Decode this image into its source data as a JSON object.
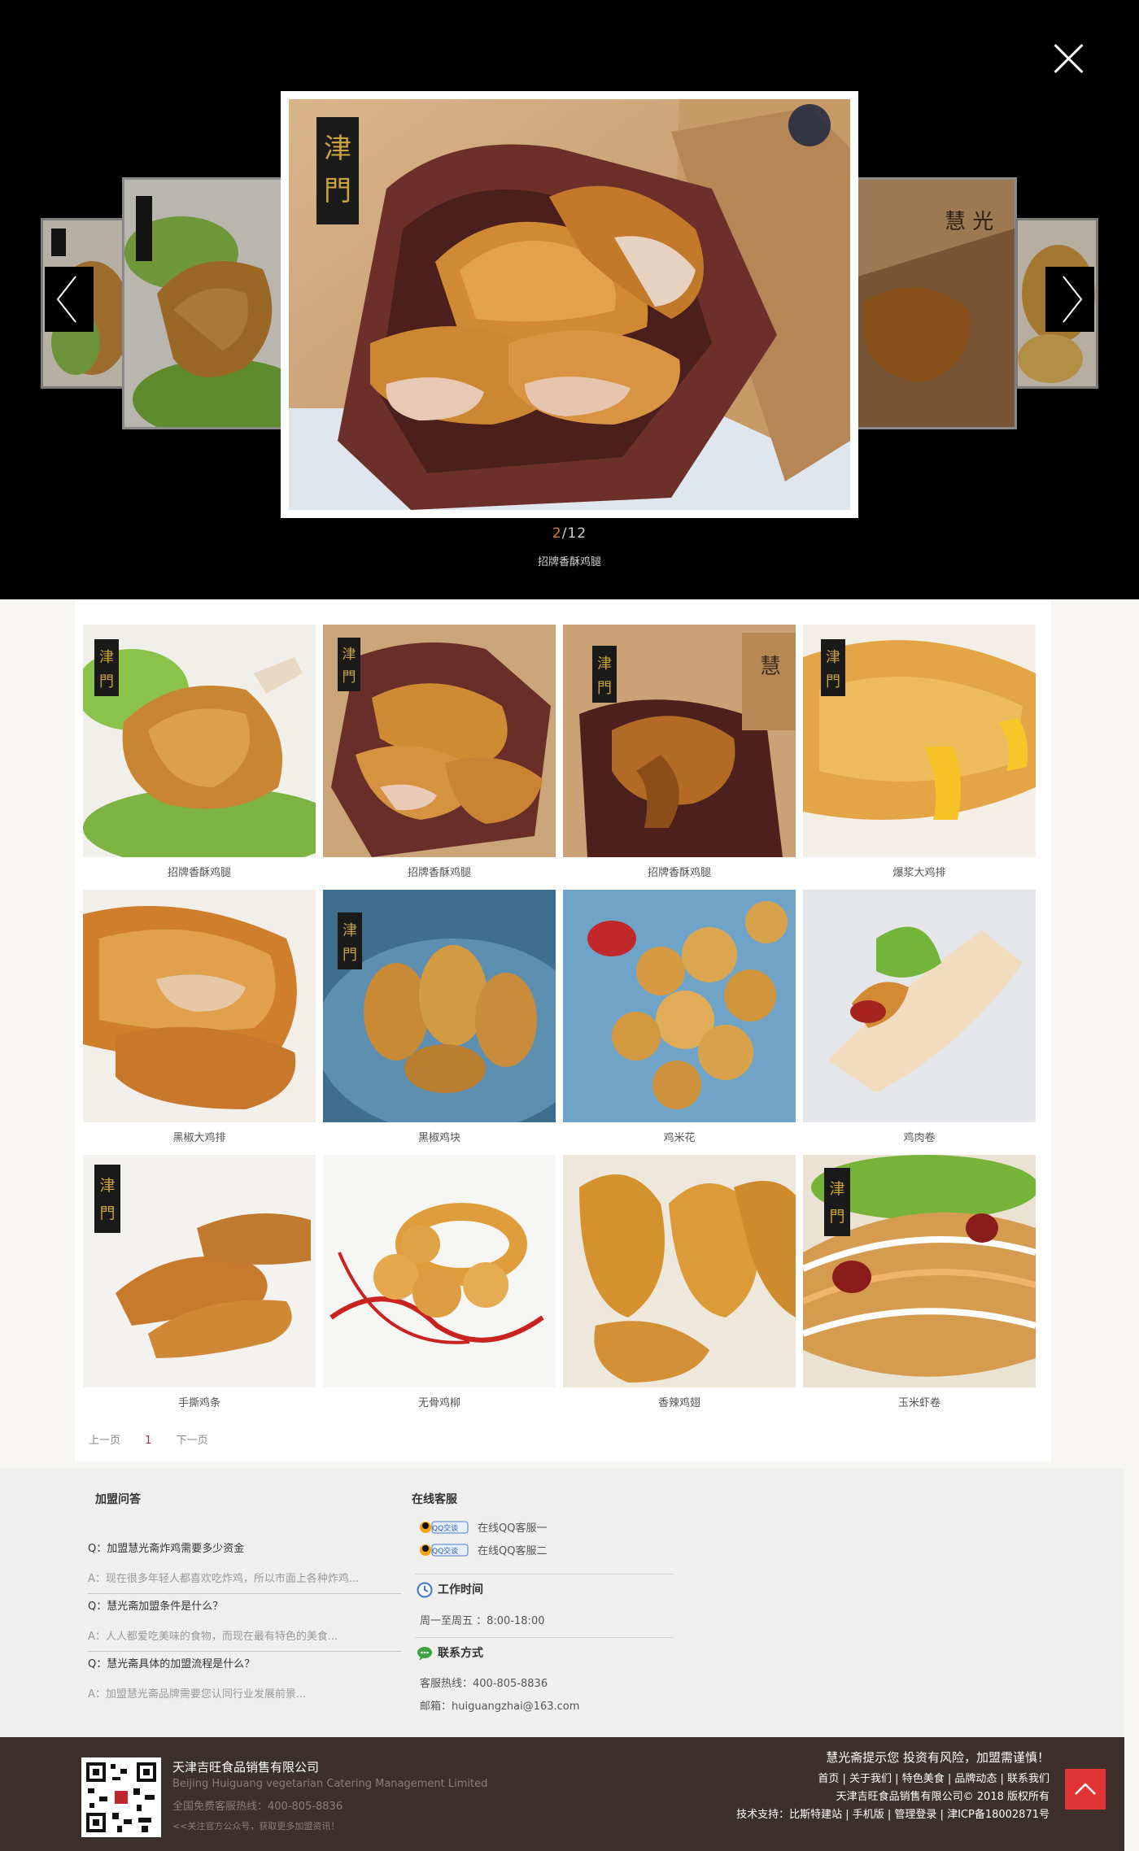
{
  "lightbox": {
    "current": "2",
    "separator": "/",
    "total": "12",
    "caption": "招牌香酥鸡腿"
  },
  "products": [
    {
      "label": "招牌香酥鸡腿",
      "icon": "fried-drumstick-on-lettuce"
    },
    {
      "label": "招牌香酥鸡腿",
      "icon": "fried-chicken-in-box"
    },
    {
      "label": "招牌香酥鸡腿",
      "icon": "fried-drumstick-in-box"
    },
    {
      "label": "爆浆大鸡排",
      "icon": "cheese-chicken-cutlet"
    },
    {
      "label": "黑椒大鸡排",
      "icon": "pepper-chicken-cutlet"
    },
    {
      "label": "黑椒鸡块",
      "icon": "chicken-nuggets-blue-plate"
    },
    {
      "label": "鸡米花",
      "icon": "popcorn-chicken-blue-plate"
    },
    {
      "label": "鸡肉卷",
      "icon": "chicken-wrap"
    },
    {
      "label": "手撕鸡条",
      "icon": "chicken-strips"
    },
    {
      "label": "无骨鸡柳",
      "icon": "boneless-chicken-tenders"
    },
    {
      "label": "香辣鸡翅",
      "icon": "spicy-chicken-wings"
    },
    {
      "label": "玉米虾卷",
      "icon": "corn-shrimp-roll"
    }
  ],
  "pager": {
    "prev": "上一页",
    "page": "1",
    "next": "下一页"
  },
  "faq": {
    "title": "加盟问答",
    "items": [
      {
        "q": "Q：加盟慧光斋炸鸡需要多少资金",
        "a": "A：现在很多年轻人都喜欢吃炸鸡，所以市面上各种炸鸡..."
      },
      {
        "q": "Q：慧光斋加盟条件是什么？",
        "a": "A：人人都爱吃美味的食物，而现在最有特色的美食..."
      },
      {
        "q": "Q：慧光斋具体的加盟流程是什么？",
        "a": "A：加盟慧光斋品牌需要您认同行业发展前景..."
      }
    ]
  },
  "service": {
    "title": "在线客服",
    "qq_badge": "QQ交谈",
    "qq1": "在线QQ客服一",
    "qq2": "在线QQ客服二",
    "hours_title": "工作时间",
    "hours": "周一至周五 ：8:00-18:00",
    "contact_title": "联系方式",
    "hotline": "客服热线：400-805-8836",
    "email": "邮箱：huiguangzhai@163.com"
  },
  "footer": {
    "company": "天津吉旺食品销售有限公司",
    "company_en": "Beijing Huiguang vegetarian Catering Management Limited",
    "hotline": "全国免费客服热线：400-805-8836",
    "wechat_tip": "<<关注官方公众号，获取更多加盟资讯！",
    "warning": "慧光斋提示您 投资有风险，加盟需谨慎！",
    "nav": "首页 | 关于我们 | 特色美食 | 品牌动态 | 联系我们",
    "copyright": "天津吉旺食品销售有限公司© 2018 版权所有",
    "tech": "技术支持：比斯特建站 | 手机版 | 管理登录 | 津ICP备18002871号"
  },
  "colors": {
    "accent": "#c0262d",
    "counter": "#e07a22",
    "footer_bg": "#3c2f2c",
    "top_btn": "#e23434"
  }
}
